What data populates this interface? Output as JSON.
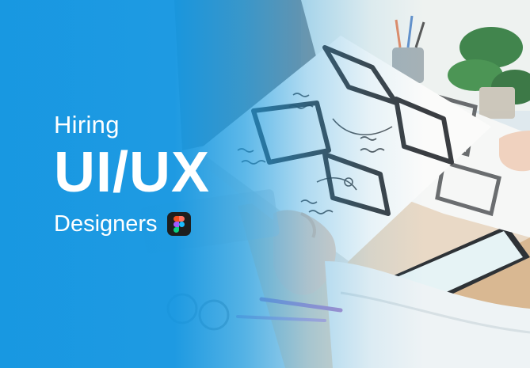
{
  "headline": {
    "hiring": "Hiring",
    "role": "UI/UX",
    "designers": "Designers"
  },
  "icons": {
    "figma_logo": "figma-icon"
  },
  "colors": {
    "brand_blue": "#1aa0e6",
    "text": "#ffffff"
  }
}
